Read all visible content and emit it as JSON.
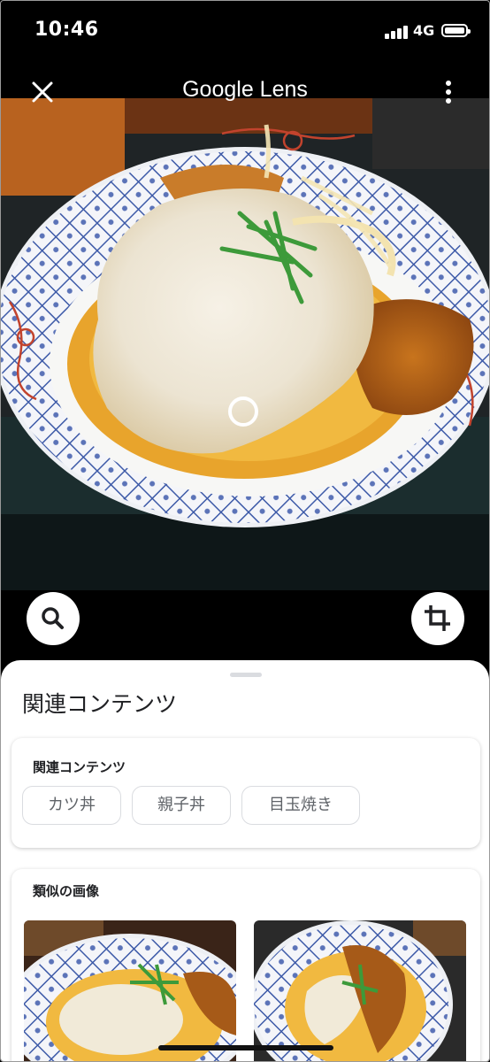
{
  "status_bar": {
    "time": "10:46",
    "network": "4G"
  },
  "top_bar": {
    "title": "Google Lens"
  },
  "sheet": {
    "title": "関連コンテンツ",
    "related_card": {
      "title": "関連コンテンツ",
      "chips": [
        "カツ丼",
        "親子丼",
        "目玉焼き"
      ]
    },
    "similar_card": {
      "title": "類似の画像"
    }
  },
  "colors": {
    "sheet_bg": "#ffffff",
    "chip_border": "#dadce0",
    "text_primary": "#202124",
    "text_secondary": "#5f6368"
  }
}
